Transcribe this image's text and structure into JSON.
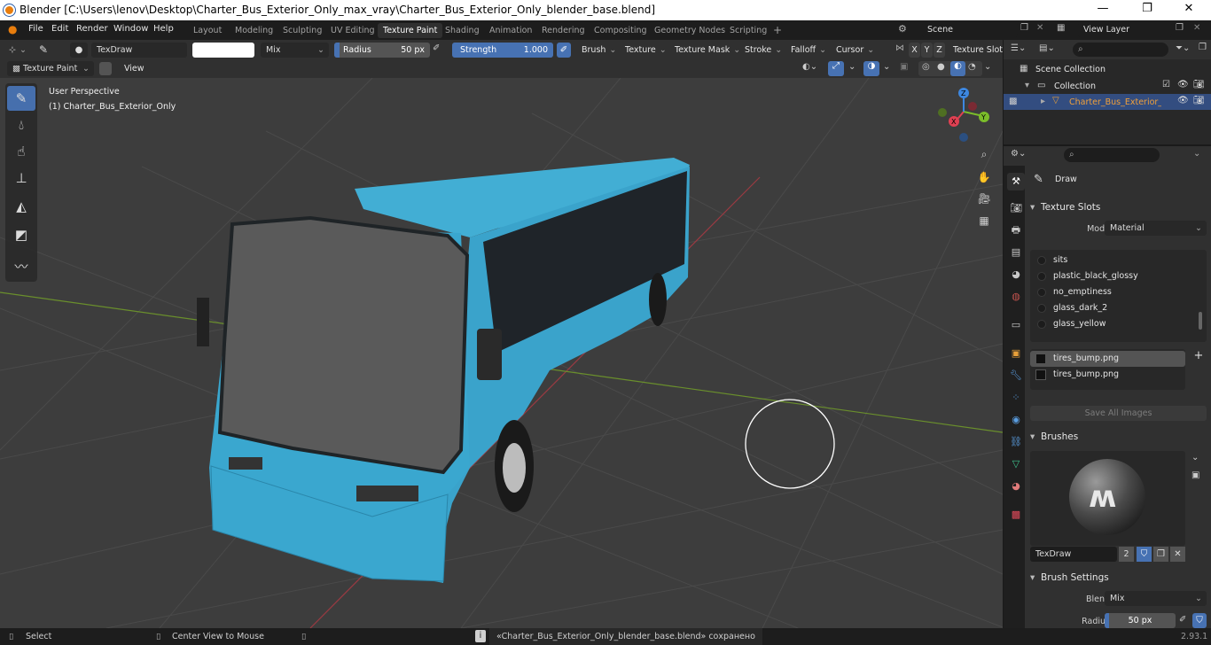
{
  "window": {
    "title": "Blender [C:\\Users\\lenov\\Desktop\\Charter_Bus_Exterior_Only_max_vray\\Charter_Bus_Exterior_Only_blender_base.blend]",
    "minimize": "—",
    "maximize": "❐",
    "close": "✕"
  },
  "menu": {
    "items": [
      "File",
      "Edit",
      "Render",
      "Window",
      "Help"
    ]
  },
  "workspaces": {
    "tabs": [
      "Layout",
      "Modeling",
      "Sculpting",
      "UV Editing",
      "Texture Paint",
      "Shading",
      "Animation",
      "Rendering",
      "Compositing",
      "Geometry Nodes",
      "Scripting"
    ],
    "active": "Texture Paint",
    "add": "+"
  },
  "scene": {
    "name": "Scene",
    "view_layer": "View Layer"
  },
  "tool_header": {
    "brush_name": "TexDraw",
    "blend": "Mix",
    "radius_label": "Radius",
    "radius_value": "50 px",
    "strength_label": "Strength",
    "strength_value": "1.000",
    "strength_fraction": 1.0,
    "menus": [
      "Brush",
      "Texture",
      "Texture Mask",
      "Stroke",
      "Falloff",
      "Cursor"
    ],
    "axes": [
      "X",
      "Y",
      "Z"
    ],
    "texture_slots": "Texture Slots"
  },
  "viewport_header": {
    "mode": "Texture Paint",
    "view": "View"
  },
  "viewport": {
    "perspective": "User Perspective",
    "object": "(1) Charter_Bus_Exterior_Only",
    "gizmo": {
      "z": "Z",
      "y": "Y",
      "x": "X"
    }
  },
  "colors": {
    "accent": "#4772b3",
    "bus_body": "#3aa7cf",
    "x_axis": "#e04052",
    "y_axis": "#7bbd2a",
    "z_axis": "#3d87e0"
  },
  "outliner": {
    "root": "Scene Collection",
    "collection": "Collection",
    "object": "Charter_Bus_Exterior_Or"
  },
  "properties": {
    "active_tool": "Draw",
    "texture_slots": {
      "title": "Texture Slots",
      "mode_label": "Mode",
      "mode_value": "Material",
      "materials": [
        "sits",
        "plastic_black_glossy",
        "no_emptiness",
        "glass_dark_2",
        "glass_yellow"
      ],
      "images": [
        "tires_bump.png",
        "tires_bump.png"
      ],
      "save_all": "Save All Images"
    },
    "brushes": {
      "title": "Brushes",
      "brush_name": "TexDraw",
      "users": "2"
    },
    "brush_settings": {
      "title": "Brush Settings",
      "blend_label": "Blend",
      "blend_value": "Mix",
      "radius_label": "Radius",
      "radius_value": "50 px"
    }
  },
  "status": {
    "select": "Select",
    "center": "Center View to Mouse",
    "message": "«Charter_Bus_Exterior_Only_blender_base.blend» сохранено",
    "version": "2.93.1"
  }
}
